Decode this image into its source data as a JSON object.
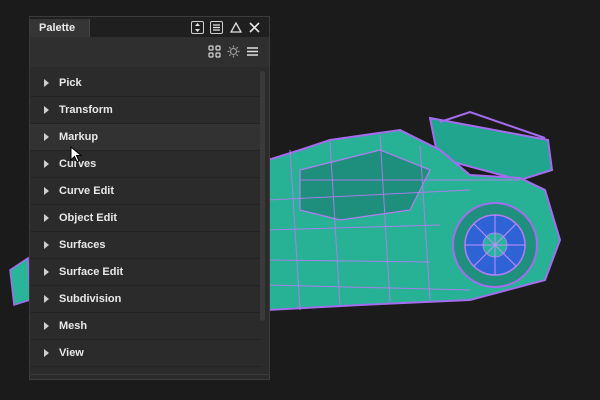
{
  "palette": {
    "tab_label": "Palette",
    "title_icons": [
      "expand-vertical-icon",
      "list-box-icon",
      "collapse-triangle-icon",
      "close-icon"
    ],
    "toolbar_icons": [
      "grid-icon",
      "settings-gear-icon",
      "menu-icon"
    ],
    "sections": [
      {
        "label": "Pick"
      },
      {
        "label": "Transform"
      },
      {
        "label": "Markup"
      },
      {
        "label": "Curves"
      },
      {
        "label": "Curve Edit"
      },
      {
        "label": "Object Edit"
      },
      {
        "label": "Surfaces"
      },
      {
        "label": "Surface Edit"
      },
      {
        "label": "Subdivision"
      },
      {
        "label": "Mesh"
      },
      {
        "label": "View"
      }
    ],
    "hovered_section": "Markup"
  },
  "viewport": {
    "background": "#1b1b1b",
    "model_colors": {
      "fill": "#2ab59a",
      "wire": "#a56cf0",
      "blue": "#3a6de0"
    }
  }
}
